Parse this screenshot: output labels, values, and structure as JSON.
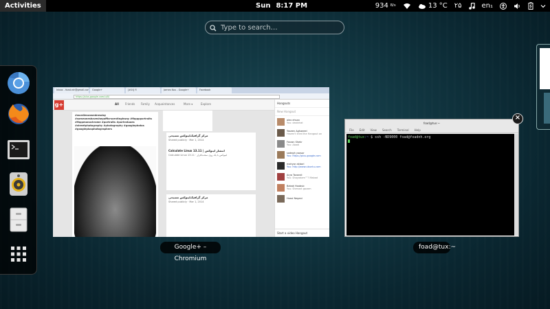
{
  "topbar": {
    "activities_label": "Activities",
    "day": "Sun",
    "time": "8:17 PM",
    "network_speed": "934",
    "network_unit": "B/s",
    "weather_temp": "13 °C",
    "persian_date": "۲۵",
    "keyboard_layout": "en₁"
  },
  "search": {
    "placeholder": "Type to search…"
  },
  "dash": {
    "items": [
      {
        "name": "chromium",
        "icon": "chromium-icon"
      },
      {
        "name": "firefox",
        "icon": "firefox-icon"
      },
      {
        "name": "terminal",
        "icon": "terminal-icon"
      },
      {
        "name": "rhythmbox",
        "icon": "speaker-icon"
      },
      {
        "name": "files",
        "icon": "files-icon"
      },
      {
        "name": "show-applications",
        "icon": "app-grid-icon"
      }
    ]
  },
  "windows": {
    "chromium": {
      "label": "Google+ – Chromium",
      "tabs": [
        "Inbox - foad.rdr@gmail.com",
        "Google+",
        "[#1t] fl",
        "James Kou - Google+",
        "Facebook"
      ],
      "url": "https://plus.google.com/u/0/",
      "nav": [
        "All",
        "Friends",
        "Family",
        "Acquaintances",
        "More ▾",
        "Explore"
      ],
      "post_hashtags": "#wordlessnwednesday\n#someoneshaveshepafficrscentinghway #fbpppportraits #fbppmonochrome #portraits #portratuoes #streetphotography #photography #googlephotos #googleplusphotographers",
      "cards": [
        {
          "title": "مرکز گرافیک‌لینوکس مسیحی",
          "text": "Shared publicly · Mar 1, 2014"
        },
        {
          "title": "Calculate Linux 13.11 | انتشار لینوکس",
          "text": "Calculate Linux 13.11 · لینوکس با یک روی سخت‌افزار"
        },
        {
          "title": "مرکز گرافیک‌لینوکس مسیحی",
          "text": "Shared publicly · Mar 1, 2014"
        }
      ],
      "hangouts": {
        "header": "Hangouts",
        "new": "New Hangout",
        "contacts": [
          {
            "name": "alex ehsan",
            "status": "You: dastkhat"
          },
          {
            "name": "Yaseen Aghaeeei",
            "status": "Haven't tried the Hangout on"
          },
          {
            "name": "Farzan Shekr",
            "status": "You: Abadi"
          },
          {
            "name": "sadegh yoosor",
            "status": "You: https://plus.google.com"
          },
          {
            "name": "mahyar akbari",
            "status": "You: http://www.ubuntu.com"
          },
          {
            "name": "Arya Tavandi",
            "status": "You: Shayadam™? Mabad"
          },
          {
            "name": "Babak Hoobsic",
            "status": "You: Shenaxt gozam"
          },
          {
            "name": "Hossi Negani",
            "status": ""
          }
        ],
        "footer": "Start a video Hangout"
      }
    },
    "terminal": {
      "label": "foad@tux:~",
      "title": "foad@tux:~",
      "menu": [
        "File",
        "Edit",
        "View",
        "Search",
        "Terminal",
        "Help"
      ],
      "prompt": "foad@tux",
      "path": ":~",
      "command": "$ ssh -ND9000 foad@foadnh.org"
    }
  }
}
